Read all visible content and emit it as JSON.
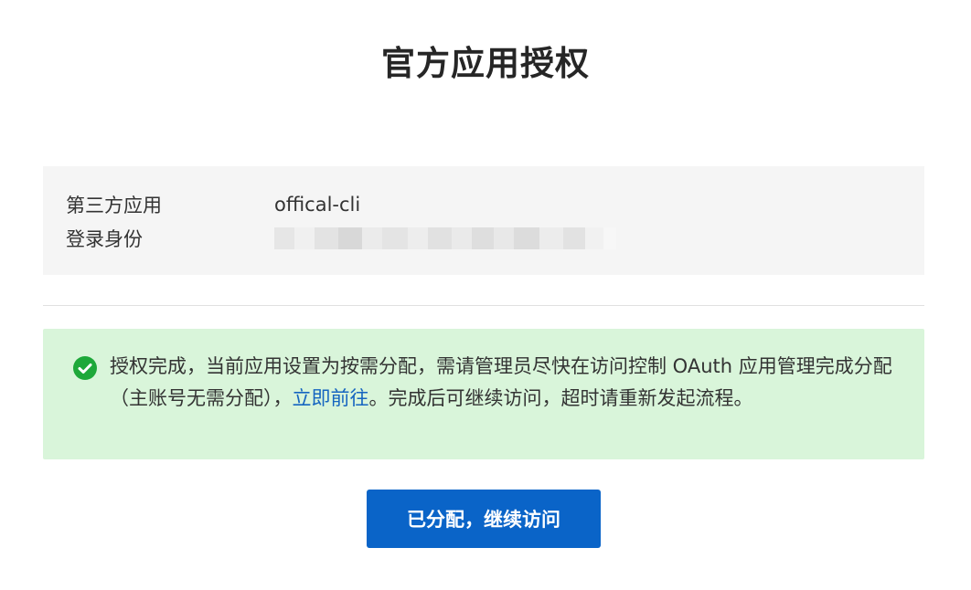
{
  "page": {
    "title": "官方应用授权"
  },
  "info": {
    "app_label": "第三方应用",
    "app_value": "offical-cli",
    "identity_label": "登录身份"
  },
  "notice": {
    "status": "success",
    "icon": "check-circle-icon",
    "text_before": "授权完成，当前应用设置为按需分配，需请管理员尽快在访问控制 OAuth 应用管理完成分配（主账号无需分配），",
    "link_text": "立即前往",
    "text_after": "。完成后可继续访问，超时请重新发起流程。"
  },
  "actions": {
    "primary_label": "已分配，继续访问"
  },
  "colors": {
    "primary": "#0a64c8",
    "success_bg": "#d9f5da",
    "success_icon": "#1ea83a",
    "link": "#1565c0",
    "panel_bg": "#f5f5f5"
  }
}
